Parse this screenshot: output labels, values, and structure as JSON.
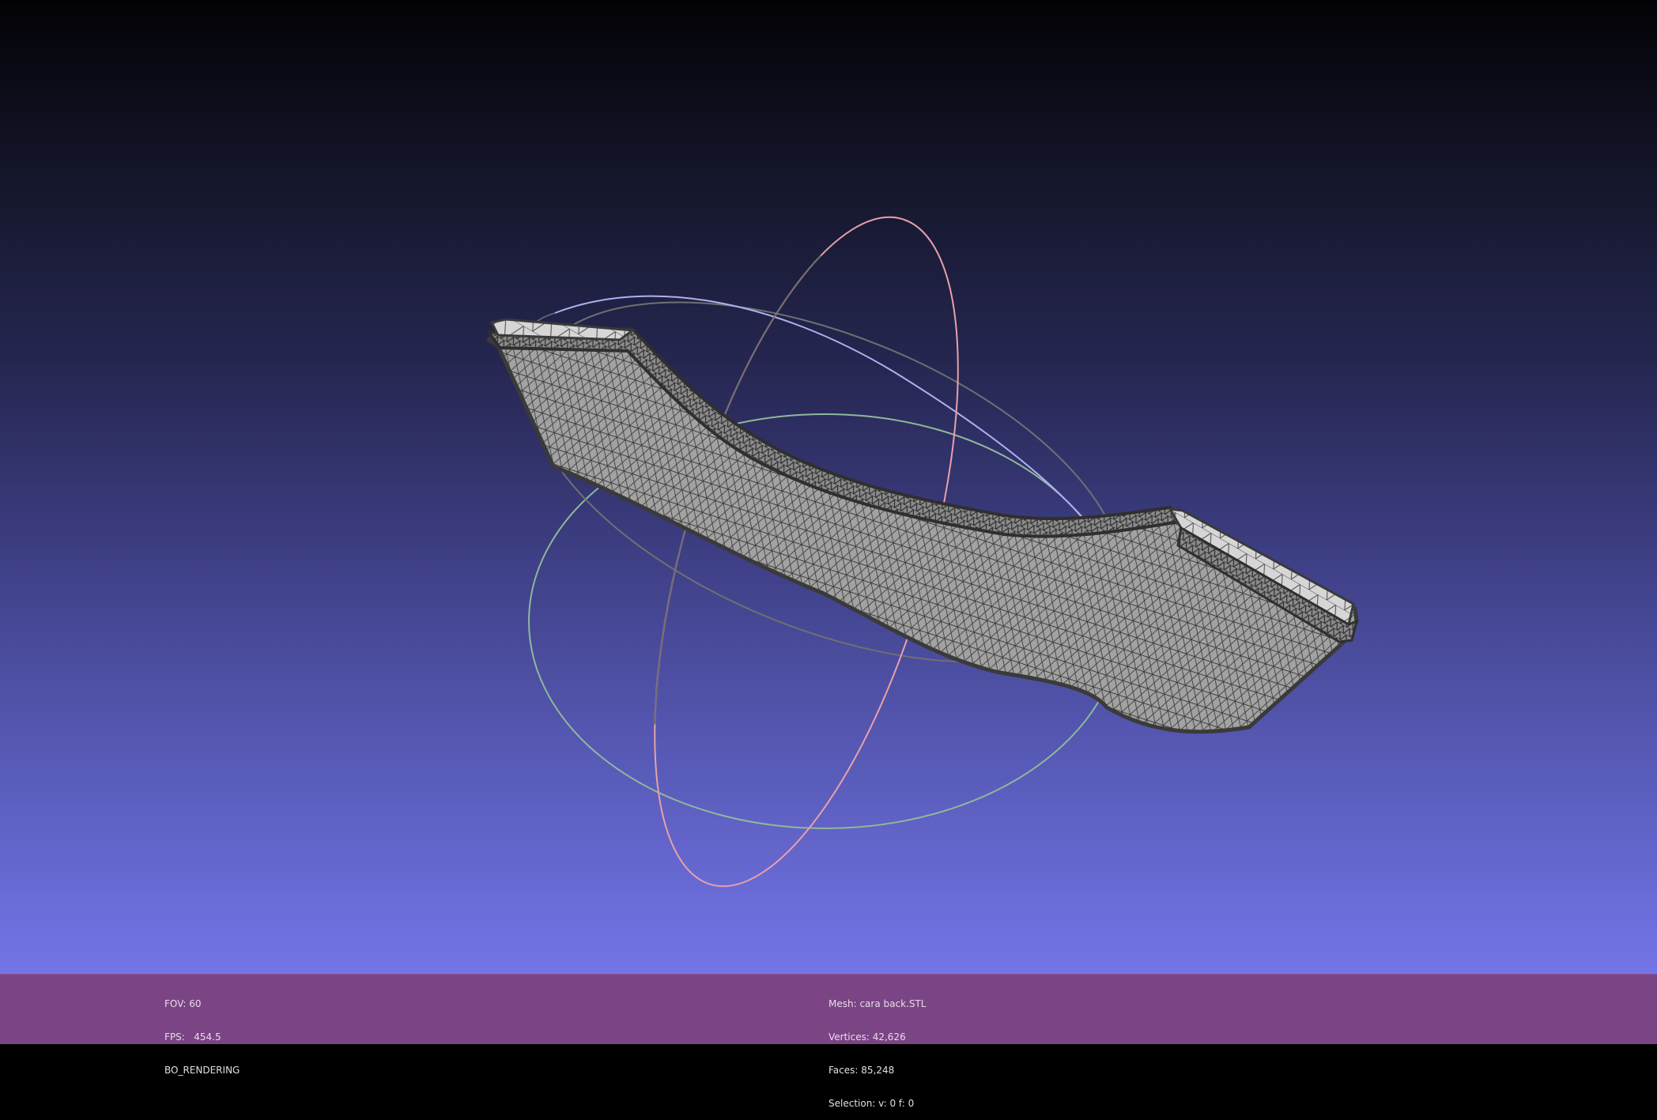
{
  "viewport": {
    "background_top": "#020206",
    "background_bottom": "#7375e8",
    "trackball": {
      "colors": {
        "red_ring": "#e8a0a8",
        "blue_ring": "#b0b0f0",
        "green_ring": "#8fb89a",
        "gray_ring": "#6f7070"
      }
    },
    "mesh": {
      "fill": "#9a9a9a",
      "edge": "#4a4a4a",
      "wire": "#3c3c3c"
    }
  },
  "info_left": {
    "fov_label": "FOV: 60",
    "fps_label": "FPS:   454.5",
    "render_mode": "BO_RENDERING"
  },
  "info_center": {
    "mesh_name": "Mesh: cara back.STL",
    "vertices": "Vertices: 42,626",
    "faces": "Faces: 85,248",
    "selection": "Selection: v: 0 f: 0"
  },
  "infobar_color": "#7b4585"
}
